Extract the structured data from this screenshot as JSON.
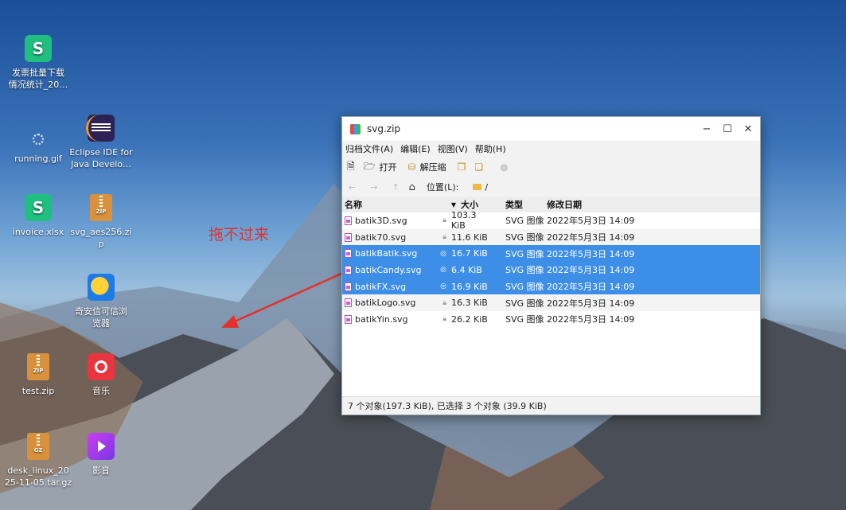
{
  "desktop": {
    "icons": [
      {
        "label": "发票批量下载\n情况统计_20…",
        "icon": "spreadsheet-icon"
      },
      {
        "label": "running.gif",
        "icon": "gif-icon"
      },
      {
        "label": "Eclipse IDE for\nJava Develo…",
        "icon": "eclipse-icon"
      },
      {
        "label": "invoice.xlsx",
        "icon": "spreadsheet-icon"
      },
      {
        "label": "svg_aes256.zi\np",
        "icon": "zip-icon"
      },
      {
        "label": "奇安信可信浏\n览器",
        "icon": "browser-icon"
      },
      {
        "label": "test.zip",
        "icon": "zip-icon"
      },
      {
        "label": "音乐",
        "icon": "music-icon"
      },
      {
        "label": "desk_linux_20\n25-11-05.tar.gz",
        "icon": "gz-icon"
      },
      {
        "label": "影音",
        "icon": "video-icon"
      }
    ],
    "zip_badge": "ZIP",
    "gz_badge": "GZ",
    "annotation": "拖不过来",
    "annotation_color": "#e3302c"
  },
  "window": {
    "title": "svg.zip",
    "controls": {
      "minimize": "−",
      "maximize": "☐",
      "close": "✕"
    },
    "menu": [
      "归档文件(A)",
      "编辑(E)",
      "视图(V)",
      "帮助(H)"
    ],
    "toolbar": {
      "open": "打开",
      "extract": "解压缩"
    },
    "location": {
      "label": "位置(L):",
      "path": "/"
    },
    "columns": {
      "name": "名称",
      "size": "大小",
      "type": "类型",
      "date": "修改日期"
    },
    "files": [
      {
        "name": "batik3D.svg",
        "size": "103.3 KiB",
        "type": "SVG 图像",
        "date": "2022年5月3日 14:09",
        "selected": false
      },
      {
        "name": "batik70.svg",
        "size": "11.6 KiB",
        "type": "SVG 图像",
        "date": "2022年5月3日 14:09",
        "selected": false
      },
      {
        "name": "batikBatik.svg",
        "size": "16.7 KiB",
        "type": "SVG 图像",
        "date": "2022年5月3日 14:09",
        "selected": true
      },
      {
        "name": "batikCandy.svg",
        "size": "6.4 KiB",
        "type": "SVG 图像",
        "date": "2022年5月3日 14:09",
        "selected": true
      },
      {
        "name": "batikFX.svg",
        "size": "16.9 KiB",
        "type": "SVG 图像",
        "date": "2022年5月3日 14:09",
        "selected": true
      },
      {
        "name": "batikLogo.svg",
        "size": "16.3 KiB",
        "type": "SVG 图像",
        "date": "2022年5月3日 14:09",
        "selected": false
      },
      {
        "name": "batikYin.svg",
        "size": "26.2 KiB",
        "type": "SVG 图像",
        "date": "2022年5月3日 14:09",
        "selected": false
      }
    ],
    "status": "7 个对象(197.3 KiB), 已选择 3 个对象 (39.9 KiB)",
    "selection_color": "#3d8ee6"
  }
}
